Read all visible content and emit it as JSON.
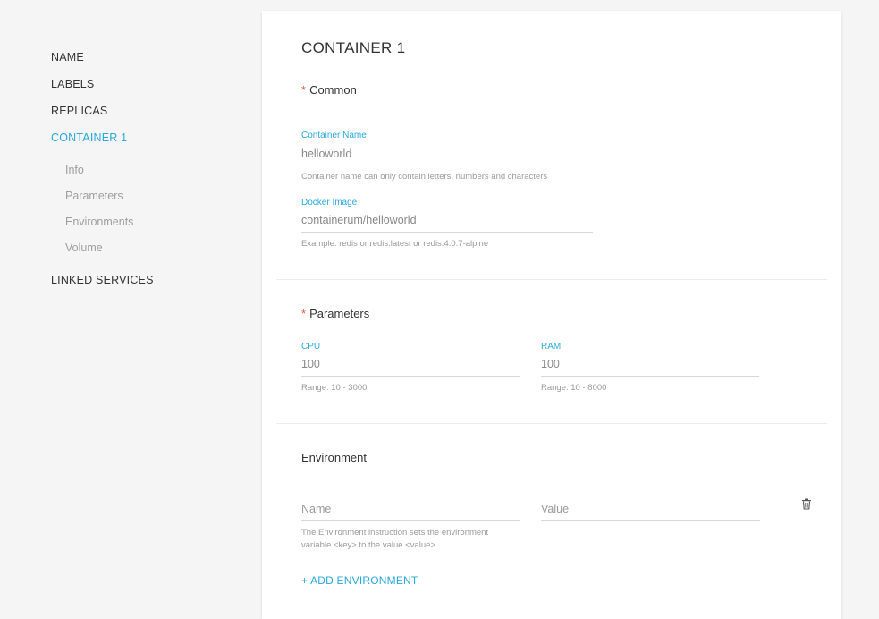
{
  "sidebar": {
    "items": [
      {
        "label": "NAME"
      },
      {
        "label": "LABELS"
      },
      {
        "label": "REPLICAS"
      },
      {
        "label": "CONTAINER 1"
      },
      {
        "label": "LINKED SERVICES"
      }
    ],
    "subitems": [
      {
        "label": "Info"
      },
      {
        "label": "Parameters"
      },
      {
        "label": "Environments"
      },
      {
        "label": "Volume"
      }
    ],
    "active_item": "CONTAINER 1",
    "active_color": "#29a8e0"
  },
  "card": {
    "title": "CONTAINER 1",
    "common": {
      "required_mark": "*",
      "title": "Common",
      "container_name": {
        "label": "Container Name",
        "value": "helloworld",
        "hint": "Container name can only contain letters, numbers and characters"
      },
      "docker_image": {
        "label": "Docker Image",
        "value": "containerum/helloworld",
        "hint": "Example: redis or redis:latest or redis:4.0.7-alpine"
      }
    },
    "parameters": {
      "required_mark": "*",
      "title": "Parameters",
      "cpu": {
        "label": "CPU",
        "value": "100",
        "hint": "Range: 10 - 3000"
      },
      "ram": {
        "label": "RAM",
        "value": "100",
        "hint": "Range: 10 - 8000"
      }
    },
    "environment": {
      "title": "Environment",
      "name_placeholder": "Name",
      "value_placeholder": "Value",
      "hint_line1": "The Environment instruction sets the environment",
      "hint_line2": "variable <key> to the value <value>",
      "delete_icon": "trash-icon",
      "add_label": "+ ADD ENVIRONMENT"
    }
  },
  "colors": {
    "accent": "#29a8e0",
    "required": "#e05a4a",
    "background": "#f5f5f5",
    "card": "#ffffff"
  }
}
